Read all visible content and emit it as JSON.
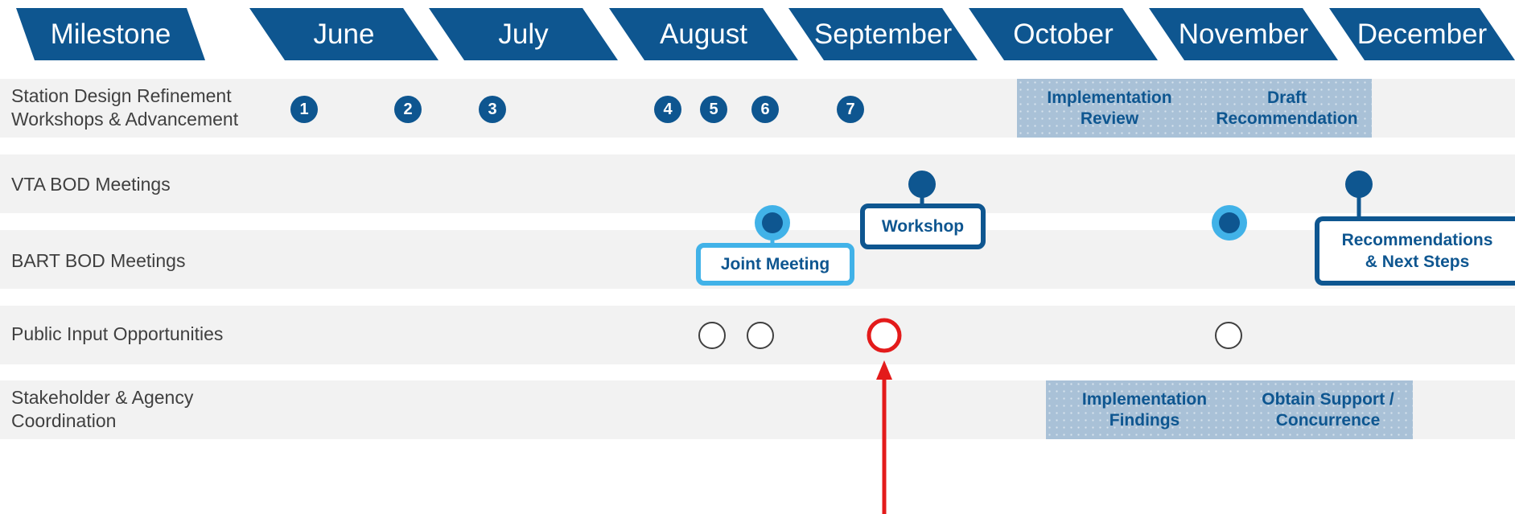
{
  "header": {
    "milestone_label": "Milestone",
    "months": [
      "June",
      "July",
      "August",
      "September",
      "October",
      "November",
      "December"
    ]
  },
  "rows": [
    {
      "label": "Station Design Refinement\nWorkshops & Advancement"
    },
    {
      "label": "VTA BOD Meetings"
    },
    {
      "label": "BART BOD Meetings"
    },
    {
      "label": "Public Input Opportunities"
    },
    {
      "label": "Stakeholder & Agency\nCoordination"
    }
  ],
  "workshop_numbers": [
    "1",
    "2",
    "3",
    "4",
    "5",
    "6",
    "7"
  ],
  "phases": {
    "implementation_review": "Implementation\nReview",
    "draft_recommendation": "Draft\nRecommendation",
    "implementation_findings": "Implementation\nFindings",
    "obtain_support": "Obtain Support /\nConcurrence"
  },
  "events": {
    "joint_meeting": "Joint Meeting",
    "workshop": "Workshop",
    "recommendations": "Recommendations\n& Next Steps"
  },
  "colors": {
    "primary": "#0e5690",
    "light_blue": "#41b2e8",
    "phase_fill": "#a9c1d7",
    "highlight": "#e31b1b",
    "row_band": "#f2f2f2"
  }
}
